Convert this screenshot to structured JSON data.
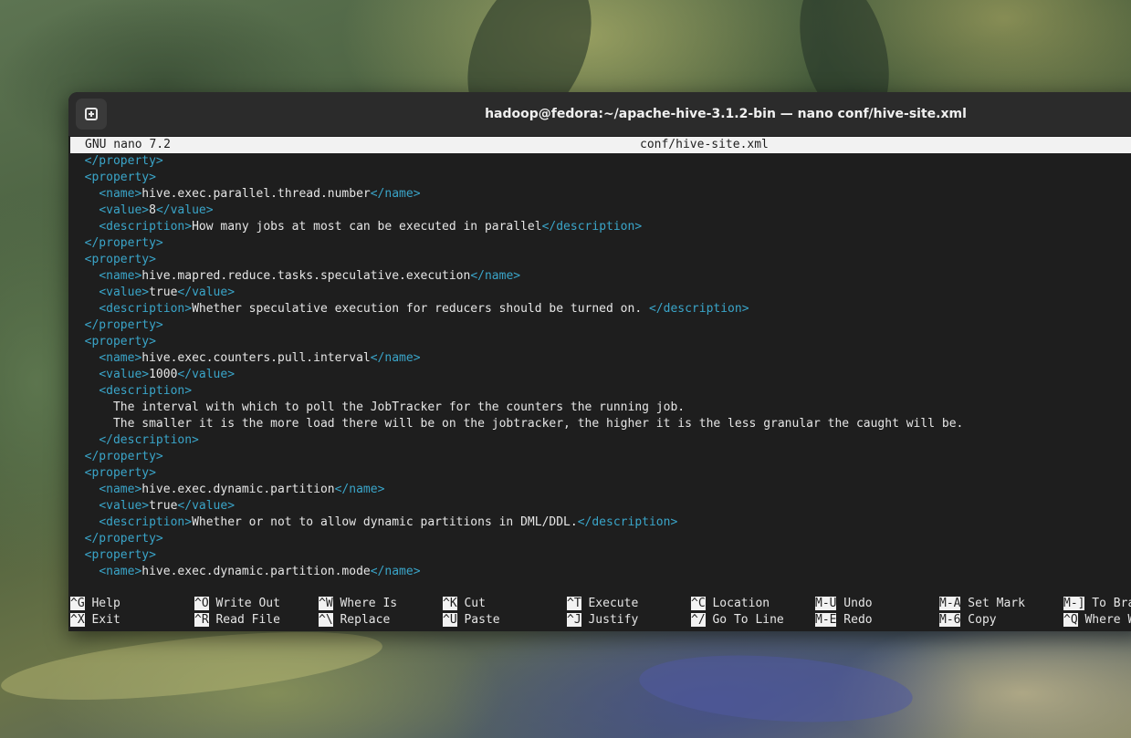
{
  "window": {
    "title": "hadoop@fedora:~/apache-hive-3.1.2-bin — nano conf/hive-site.xml"
  },
  "nano": {
    "version": "GNU nano 7.2",
    "filename": "conf/hive-site.xml"
  },
  "lines": [
    {
      "i": 0,
      "parts": [
        [
          "t",
          "</property>"
        ]
      ]
    },
    {
      "i": 0,
      "parts": [
        [
          "t",
          "<property>"
        ]
      ]
    },
    {
      "i": 1,
      "parts": [
        [
          "t",
          "<name>"
        ],
        [
          "x",
          "hive.exec.parallel.thread.number"
        ],
        [
          "t",
          "</name>"
        ]
      ]
    },
    {
      "i": 1,
      "parts": [
        [
          "t",
          "<value>"
        ],
        [
          "x",
          "8"
        ],
        [
          "t",
          "</value>"
        ]
      ]
    },
    {
      "i": 1,
      "parts": [
        [
          "t",
          "<description>"
        ],
        [
          "x",
          "How many jobs at most can be executed in parallel"
        ],
        [
          "t",
          "</description>"
        ]
      ]
    },
    {
      "i": 0,
      "parts": [
        [
          "t",
          "</property>"
        ]
      ]
    },
    {
      "i": 0,
      "parts": [
        [
          "t",
          "<property>"
        ]
      ]
    },
    {
      "i": 1,
      "parts": [
        [
          "t",
          "<name>"
        ],
        [
          "x",
          "hive.mapred.reduce.tasks.speculative.execution"
        ],
        [
          "t",
          "</name>"
        ]
      ]
    },
    {
      "i": 1,
      "parts": [
        [
          "t",
          "<value>"
        ],
        [
          "x",
          "true"
        ],
        [
          "t",
          "</value>"
        ]
      ]
    },
    {
      "i": 1,
      "parts": [
        [
          "t",
          "<description>"
        ],
        [
          "x",
          "Whether speculative execution for reducers should be turned on. "
        ],
        [
          "t",
          "</description>"
        ]
      ]
    },
    {
      "i": 0,
      "parts": [
        [
          "t",
          "</property>"
        ]
      ]
    },
    {
      "i": 0,
      "parts": [
        [
          "t",
          "<property>"
        ]
      ]
    },
    {
      "i": 1,
      "parts": [
        [
          "t",
          "<name>"
        ],
        [
          "x",
          "hive.exec.counters.pull.interval"
        ],
        [
          "t",
          "</name>"
        ]
      ]
    },
    {
      "i": 1,
      "parts": [
        [
          "t",
          "<value>"
        ],
        [
          "x",
          "1000"
        ],
        [
          "t",
          "</value>"
        ]
      ]
    },
    {
      "i": 1,
      "parts": [
        [
          "t",
          "<description>"
        ]
      ]
    },
    {
      "i": 2,
      "parts": [
        [
          "x",
          "The interval with which to poll the JobTracker for the counters the running job."
        ]
      ]
    },
    {
      "i": 2,
      "parts": [
        [
          "x",
          "The smaller it is the more load there will be on the jobtracker, the higher it is the less granular the caught will be."
        ]
      ]
    },
    {
      "i": 1,
      "parts": [
        [
          "t",
          "</description>"
        ]
      ]
    },
    {
      "i": 0,
      "parts": [
        [
          "t",
          "</property>"
        ]
      ]
    },
    {
      "i": 0,
      "parts": [
        [
          "t",
          "<property>"
        ]
      ]
    },
    {
      "i": 1,
      "parts": [
        [
          "t",
          "<name>"
        ],
        [
          "x",
          "hive.exec.dynamic.partition"
        ],
        [
          "t",
          "</name>"
        ]
      ]
    },
    {
      "i": 1,
      "parts": [
        [
          "t",
          "<value>"
        ],
        [
          "x",
          "true"
        ],
        [
          "t",
          "</value>"
        ]
      ]
    },
    {
      "i": 1,
      "parts": [
        [
          "t",
          "<description>"
        ],
        [
          "x",
          "Whether or not to allow dynamic partitions in DML/DDL."
        ],
        [
          "t",
          "</description>"
        ]
      ]
    },
    {
      "i": 0,
      "parts": [
        [
          "t",
          "</property>"
        ]
      ]
    },
    {
      "i": 0,
      "parts": [
        [
          "t",
          "<property>"
        ]
      ]
    },
    {
      "i": 1,
      "parts": [
        [
          "t",
          "<name>"
        ],
        [
          "x",
          "hive.exec.dynamic.partition.mode"
        ],
        [
          "t",
          "</name>"
        ]
      ]
    }
  ],
  "shortcuts": [
    {
      "key": "^G",
      "label": "Help"
    },
    {
      "key": "^X",
      "label": "Exit"
    },
    {
      "key": "^O",
      "label": "Write Out"
    },
    {
      "key": "^R",
      "label": "Read File"
    },
    {
      "key": "^W",
      "label": "Where Is"
    },
    {
      "key": "^\\",
      "label": "Replace"
    },
    {
      "key": "^K",
      "label": "Cut"
    },
    {
      "key": "^U",
      "label": "Paste"
    },
    {
      "key": "^T",
      "label": "Execute"
    },
    {
      "key": "^J",
      "label": "Justify"
    },
    {
      "key": "^C",
      "label": "Location"
    },
    {
      "key": "^/",
      "label": "Go To Line"
    },
    {
      "key": "M-U",
      "label": "Undo"
    },
    {
      "key": "M-E",
      "label": "Redo"
    },
    {
      "key": "M-A",
      "label": "Set Mark"
    },
    {
      "key": "M-6",
      "label": "Copy"
    },
    {
      "key": "M-]",
      "label": "To Bra"
    },
    {
      "key": "^Q",
      "label": "Where W"
    }
  ],
  "colors": {
    "tag": "#3aa5c9",
    "text": "#e6e6e6",
    "background": "#1e1e1e",
    "inverse": "#f2f2f2"
  }
}
